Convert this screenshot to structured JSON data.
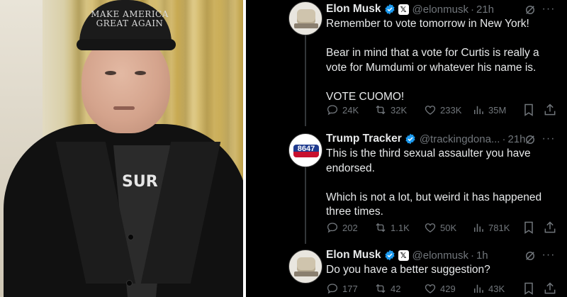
{
  "photo": {
    "cap_text_line1": "MAKE AMERICA",
    "cap_text_line2": "GREAT AGAIN",
    "shirt_text": "SUR"
  },
  "tweets": [
    {
      "name": "Elon Musk",
      "handle": "@elonmusk",
      "separator": "·",
      "time": "21h",
      "paragraphs": [
        "Remember to vote tomorrow in New York!",
        "Bear in mind that a vote for Curtis is really a vote for Mumdumi or whatever his name is.",
        "VOTE CUOMO!"
      ],
      "replies": "24K",
      "reposts": "32K",
      "likes": "233K",
      "views": "35M"
    },
    {
      "name": "Trump Tracker",
      "handle": "@trackingdona...",
      "separator": "·",
      "time": "21h",
      "avatar_text": "8647",
      "paragraphs": [
        "This is the third sexual assaulter you have endorsed.",
        "Which is not a lot, but weird it has happened three times."
      ],
      "replies": "202",
      "reposts": "1.1K",
      "likes": "50K",
      "views": "781K"
    },
    {
      "name": "Elon Musk",
      "handle": "@elonmusk",
      "separator": "·",
      "time": "1h",
      "paragraphs": [
        "Do you have a better suggestion?"
      ],
      "replies": "177",
      "reposts": "42",
      "likes": "429",
      "views": "43K"
    }
  ],
  "icons": {
    "verified": "verified-badge-icon",
    "x_affiliate": "𝕏",
    "grok": "grok-icon",
    "more": "···",
    "reply": "reply-icon",
    "repost": "repost-icon",
    "like": "like-icon",
    "views": "views-icon",
    "bookmark": "bookmark-icon",
    "share": "share-icon"
  },
  "colors": {
    "background": "#000000",
    "text": "#e7e9ea",
    "muted": "#71767b",
    "verified": "#1d9bf0"
  }
}
